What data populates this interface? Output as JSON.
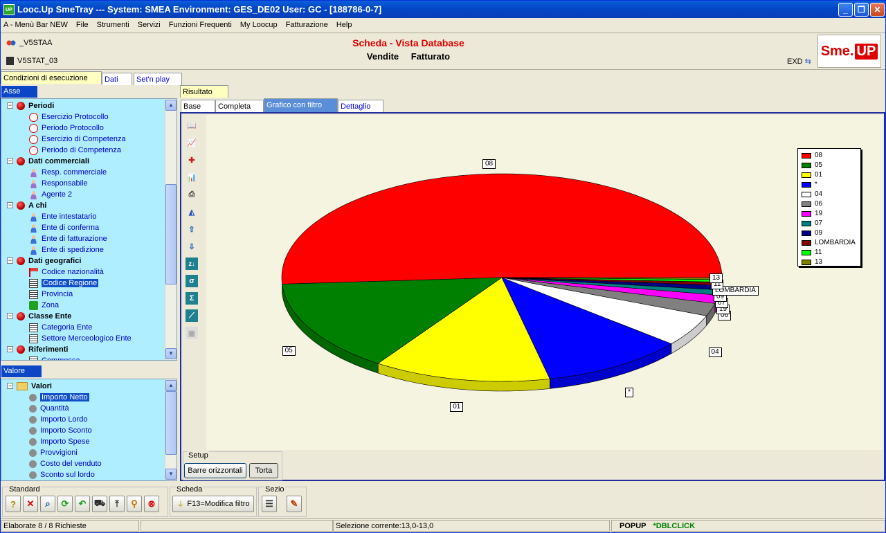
{
  "window": {
    "title": "Looc.Up SmeTray --- System: SMEA Environment: GES_DE02 User: GC - [188786-0-7]",
    "app_icon_text": "UP"
  },
  "menu": [
    "A - Menù Bar NEW",
    "File",
    "Strumenti",
    "Servizi",
    "Funzioni Frequenti",
    "My Loocup",
    "Fatturazione",
    "Help"
  ],
  "header": {
    "left1": "_V5STAA",
    "left2": "V5STAT_03",
    "title": "Scheda - Vista Database",
    "sub1": "Vendite",
    "sub2": "Fatturato",
    "exd": "EXD",
    "logo_left": "Sme.",
    "logo_right": "UP"
  },
  "top_tabs": [
    "Condizioni di esecuzione",
    "Dati",
    "Set'n play"
  ],
  "asse": {
    "label": "Asse",
    "rows": [
      {
        "text": "Periodi",
        "type": "group"
      },
      {
        "text": "Esercizio Protocollo",
        "icon": "clock"
      },
      {
        "text": "Periodo Protocollo",
        "icon": "clock"
      },
      {
        "text": "Esercizio di Competenza",
        "icon": "clock"
      },
      {
        "text": "Periodo di Competenza",
        "icon": "clock"
      },
      {
        "text": "Dati commerciali",
        "type": "group"
      },
      {
        "text": "Resp. commerciale",
        "icon": "person2"
      },
      {
        "text": "Responsabile",
        "icon": "person2"
      },
      {
        "text": "Agente 2",
        "icon": "person2"
      },
      {
        "text": "A chi",
        "type": "group"
      },
      {
        "text": "Ente intestatario",
        "icon": "person"
      },
      {
        "text": "Ente di conferma",
        "icon": "person"
      },
      {
        "text": "Ente di fatturazione",
        "icon": "person"
      },
      {
        "text": "Ente di spedizione",
        "icon": "person"
      },
      {
        "text": "Dati geografici",
        "type": "group"
      },
      {
        "text": "Codice nazionalità",
        "icon": "flag"
      },
      {
        "text": "Codice Regione",
        "icon": "grid",
        "selected": true
      },
      {
        "text": "Provincia",
        "icon": "grid"
      },
      {
        "text": "Zona",
        "icon": "green"
      },
      {
        "text": "Classe Ente",
        "type": "group"
      },
      {
        "text": "Categoria Ente",
        "icon": "grid"
      },
      {
        "text": "Settore Merceologico Ente",
        "icon": "grid"
      },
      {
        "text": "Riferimenti",
        "type": "group"
      },
      {
        "text": "Commessa",
        "icon": "grid"
      }
    ]
  },
  "valore": {
    "label": "Valore",
    "rows": [
      {
        "text": "Valori",
        "type": "folder"
      },
      {
        "text": "Importo Netto",
        "selected": true
      },
      {
        "text": "Quantità"
      },
      {
        "text": "Importo Lordo"
      },
      {
        "text": "Importo Sconto"
      },
      {
        "text": "Importo Spese"
      },
      {
        "text": "Provvigioni"
      },
      {
        "text": "Costo del venduto"
      },
      {
        "text": "Sconto sul lordo"
      }
    ]
  },
  "result_tab": "Risultato",
  "sub_tabs": [
    "Base",
    "Completa",
    "Grafico con filtro",
    "Dettaglio"
  ],
  "setup": {
    "label": "Setup",
    "btn1": "Barre orizzontali",
    "btn2": "Torta"
  },
  "toolbars": {
    "standard": "Standard",
    "scheda": "Scheda",
    "sezio": "Sezio",
    "filter_btn": "F13=Modifica filtro"
  },
  "status": {
    "left": "Elaborate 8 / 8 Richieste",
    "middle": "Selezione corrente:13,0-13,0",
    "popup": "POPUP",
    "dblclick": "*DBLCLICK"
  },
  "chart_data": {
    "type": "pie",
    "categories": [
      "08",
      "05",
      "01",
      "*",
      "04",
      "06",
      "19",
      "07",
      "09",
      "LOMBARDIA",
      "11",
      "13"
    ],
    "values": [
      51.0,
      14.5,
      13.0,
      10.5,
      5.0,
      2.0,
      1.3,
      0.8,
      0.7,
      0.5,
      0.4,
      0.3
    ],
    "colors": [
      "#ff0000",
      "#008000",
      "#ffff00",
      "#0000ff",
      "#ffffff",
      "#808080",
      "#ff00ff",
      "#008080",
      "#000080",
      "#800000",
      "#00ff00",
      "#808000"
    ],
    "legend_position": "right"
  }
}
